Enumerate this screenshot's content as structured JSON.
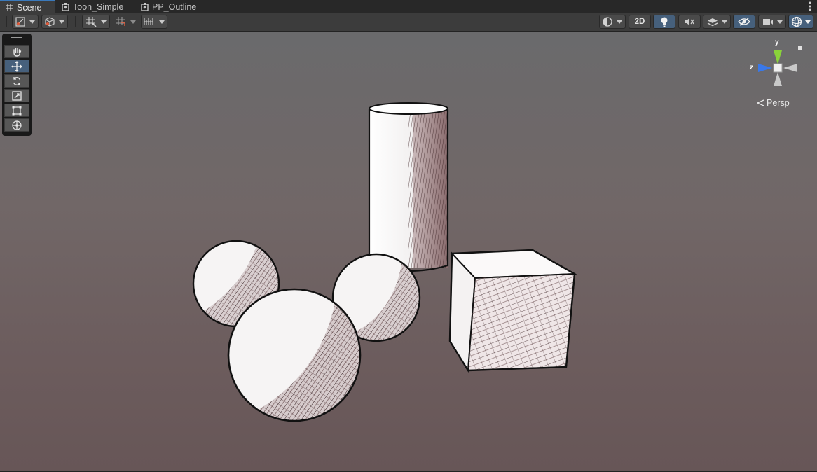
{
  "tabs": [
    {
      "label": "Scene",
      "icon": "grid-icon",
      "active": true
    },
    {
      "label": "Toon_Simple",
      "icon": "prefab-gear-icon",
      "active": false
    },
    {
      "label": "PP_Outline",
      "icon": "prefab-gear-icon",
      "active": false
    }
  ],
  "toolbar": {
    "view_mode_2d_label": "2D"
  },
  "gizmo": {
    "axis_y": "y",
    "axis_z": "z",
    "projection_label": "Persp"
  },
  "colors": {
    "accent_blue": "#46607c",
    "tab_highlight": "#3a79bb",
    "gizmo_y": "#8ad33a",
    "gizmo_z": "#3a78e8"
  }
}
